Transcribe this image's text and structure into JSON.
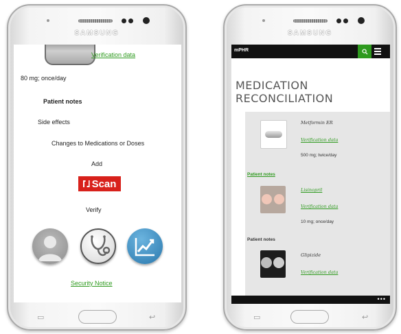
{
  "device": {
    "brand": "SAMSUNG"
  },
  "phone1": {
    "verification_link": "Verification data",
    "dosage": "80 mg; once/day",
    "patient_notes": "Patient notes",
    "side_effects": "Side effects",
    "changes": "Changes to Medications or Doses",
    "add": "Add",
    "scan_button": "Scan",
    "verify": "Verify",
    "icons": [
      "user-avatar-icon",
      "stethoscope-icon",
      "trend-chart-icon"
    ],
    "security_notice": "Security Notice"
  },
  "phone2": {
    "app_title": "mPHR",
    "heading_line1": "MEDICATION",
    "heading_line2": "RECONCILIATION",
    "medications": [
      {
        "name": "Metformin ER",
        "verification": "Verification data",
        "dosage": "500 mg; twice/day",
        "notes": "Patient notes"
      },
      {
        "name": "Lisinopril",
        "verification": "Verification data",
        "dosage": "10 mg; once/day",
        "notes": "Patient notes"
      },
      {
        "name": "Glipizide",
        "verification": "Verification data"
      }
    ],
    "overflow_menu": "•••"
  },
  "colors": {
    "accent_green": "#2e9a1e",
    "scan_red": "#d8211b",
    "appbar": "#111111",
    "panel": "#e6e6e6"
  }
}
